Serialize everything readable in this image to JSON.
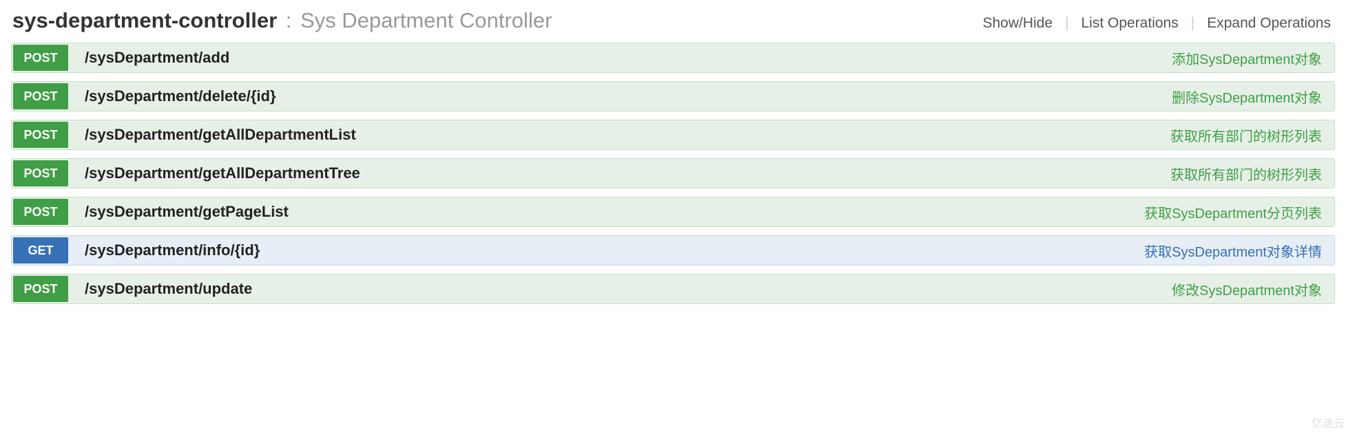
{
  "header": {
    "controller_name": "sys-department-controller",
    "separator": ":",
    "controller_desc": "Sys Department Controller",
    "actions": {
      "show_hide": "Show/Hide",
      "list_ops": "List Operations",
      "expand_ops": "Expand Operations"
    }
  },
  "operations": [
    {
      "method": "POST",
      "method_class": "post",
      "path": "/sysDepartment/add",
      "summary": "添加SysDepartment对象"
    },
    {
      "method": "POST",
      "method_class": "post",
      "path": "/sysDepartment/delete/{id}",
      "summary": "删除SysDepartment对象"
    },
    {
      "method": "POST",
      "method_class": "post",
      "path": "/sysDepartment/getAllDepartmentList",
      "summary": "获取所有部门的树形列表"
    },
    {
      "method": "POST",
      "method_class": "post",
      "path": "/sysDepartment/getAllDepartmentTree",
      "summary": "获取所有部门的树形列表"
    },
    {
      "method": "POST",
      "method_class": "post",
      "path": "/sysDepartment/getPageList",
      "summary": "获取SysDepartment分页列表"
    },
    {
      "method": "GET",
      "method_class": "get",
      "path": "/sysDepartment/info/{id}",
      "summary": "获取SysDepartment对象详情"
    },
    {
      "method": "POST",
      "method_class": "post",
      "path": "/sysDepartment/update",
      "summary": "修改SysDepartment对象"
    }
  ],
  "watermark": "亿速云"
}
